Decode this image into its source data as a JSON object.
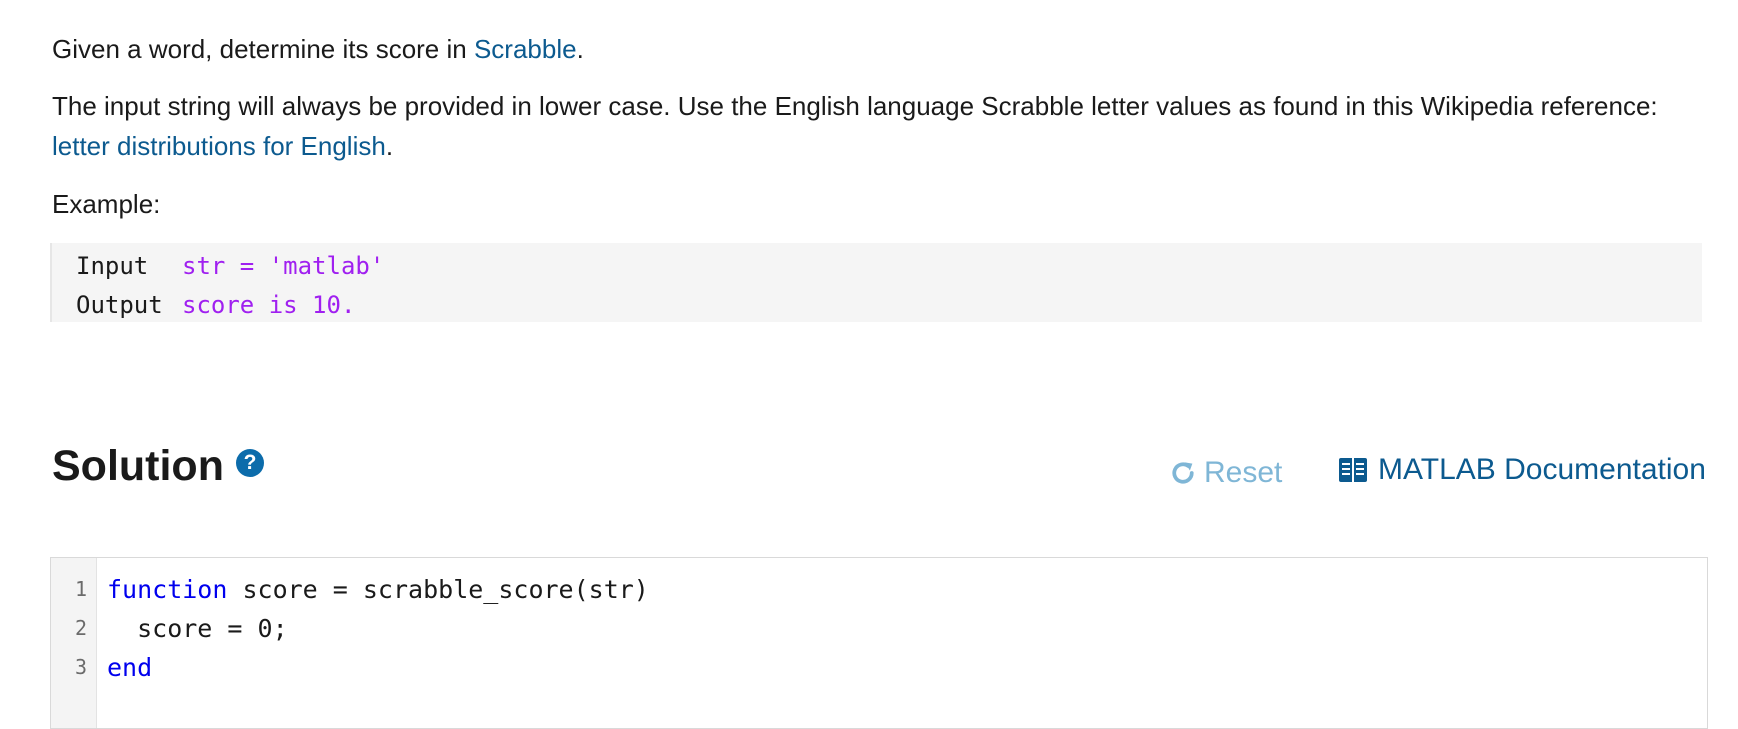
{
  "description": {
    "line1_prefix": "Given a word, determine its score in ",
    "line1_link": "Scrabble",
    "line1_suffix": ".",
    "line2_prefix": "The input string will always be provided in lower case. Use the English language Scrabble letter values as found in this Wikipedia reference: ",
    "line2_link": "letter distributions for English",
    "line2_suffix": ".",
    "example_label": "Example:"
  },
  "example": {
    "rows": [
      {
        "label": "Input",
        "value": "str = 'matlab'"
      },
      {
        "label": "Output",
        "value": "score is 10."
      }
    ]
  },
  "solution": {
    "title": "Solution",
    "help_glyph": "?",
    "reset_label": "Reset",
    "reset_icon": "refresh-icon",
    "doc_label": "MATLAB Documentation",
    "doc_icon": "book-icon"
  },
  "editor": {
    "lines": [
      {
        "number": "1",
        "keyword": "function",
        "text": " score = scrabble_score(str)"
      },
      {
        "number": "2",
        "keyword": "",
        "text": "  score = 0;"
      },
      {
        "number": "3",
        "keyword": "end",
        "text": ""
      }
    ]
  },
  "colors": {
    "link": "#0c5a8f",
    "code_string": "#a020f0",
    "keyword": "#0000ee",
    "reset": "#7fb6d6"
  }
}
